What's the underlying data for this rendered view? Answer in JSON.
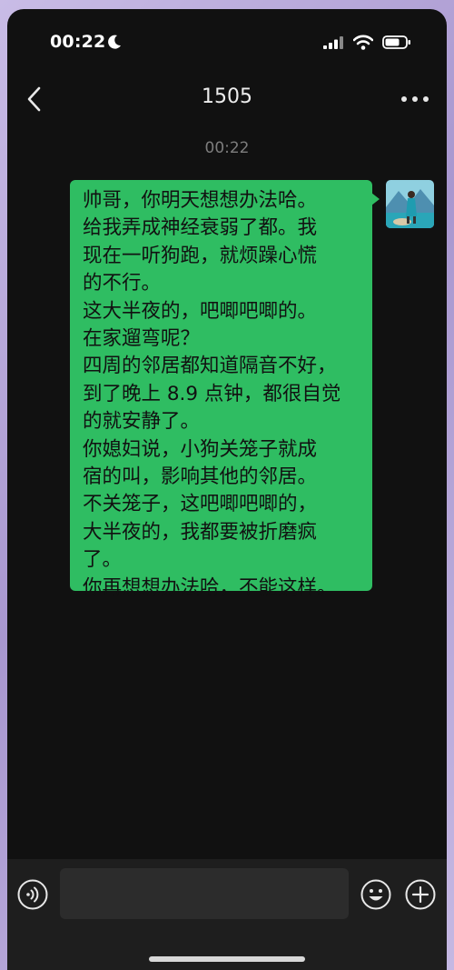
{
  "status_bar": {
    "time": "00:22",
    "icons": [
      "moon-icon",
      "signal-icon",
      "wifi-icon",
      "battery-icon"
    ]
  },
  "header": {
    "title": "1505",
    "back_icon": "chevron-left-icon",
    "more_icon": "more-dots-icon"
  },
  "chat": {
    "timestamp": "00:22",
    "messages": [
      {
        "sender": "self",
        "bubble_color": "#2fbd62",
        "lines": [
          "帅哥，你明天想想办法哈。",
          "给我弄成神经衰弱了都。我",
          "现在一听狗跑，就烦躁心慌",
          "的不行。",
          "这大半夜的，吧唧吧唧的。",
          "在家遛弯呢？",
          "四周的邻居都知道隔音不好，",
          "到了晚上 8.9 点钟，都很自觉",
          "的就安静了。",
          "你媳妇说，小狗关笼子就成",
          "宿的叫，影响其他的邻居。",
          "不关笼子，这吧唧吧唧的，",
          "大半夜的，我都要被折磨疯",
          "了。",
          "你再想想办法哈，不能这样。"
        ]
      }
    ]
  },
  "input_bar": {
    "message_value": "",
    "icons": [
      "voice-icon",
      "emoji-icon",
      "plus-icon"
    ]
  },
  "colors": {
    "background": "#111111",
    "bubble": "#2fbd62",
    "input_bar": "#1e1e1e",
    "input_field": "#2c2c2c"
  }
}
